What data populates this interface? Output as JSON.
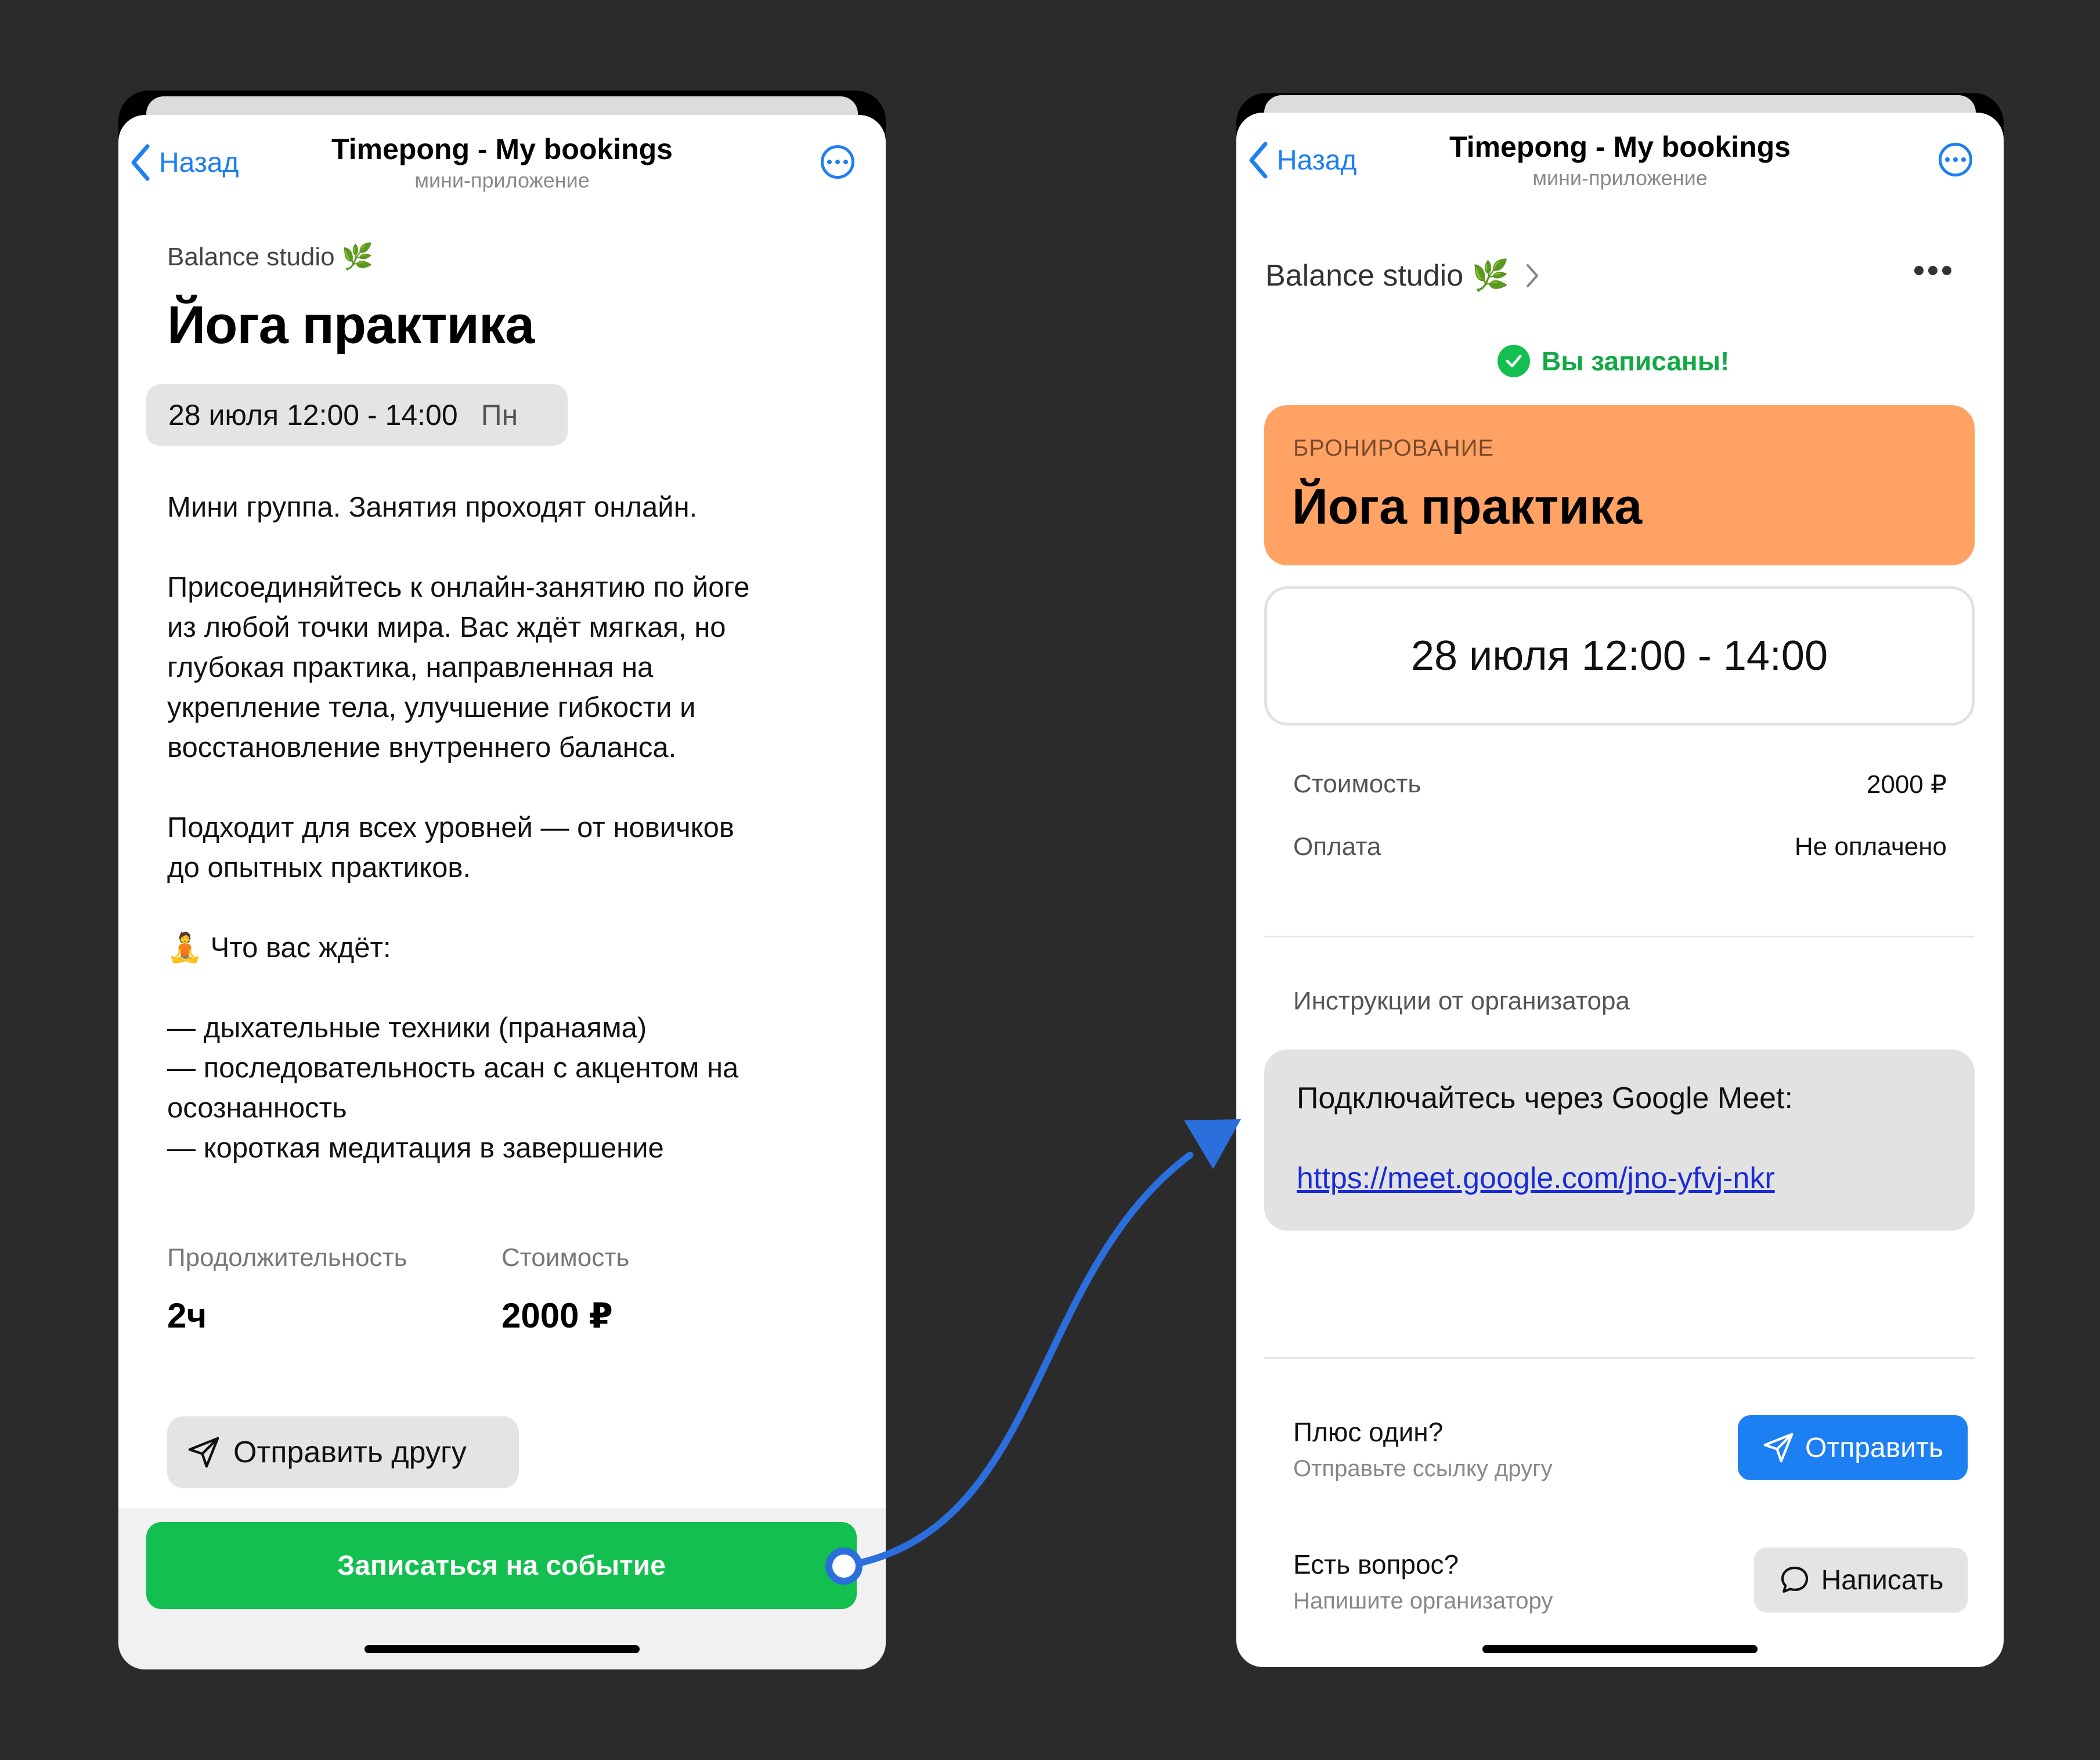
{
  "colors": {
    "accent": "#1c7ff2",
    "green": "#12bf4f",
    "orange": "#ffa264",
    "link": "#1a2bd8",
    "background": "#2b2b2b"
  },
  "header": {
    "back_label": "Назад",
    "title": "Timepong - My bookings",
    "subtitle": "мини-приложение"
  },
  "event": {
    "studio": "Balance studio 🌿",
    "title": "Йога практика",
    "date": "28 июля 12:00 - 14:00",
    "weekday": "Пн",
    "description": [
      "Мини группа. Занятия проходят онлайн.",
      "Присоединяйтесь к онлайн-занятию по йоге\nиз любой точки мира. Вас ждёт мягкая, но\nглубокая практика, направленная на\nукрепление тела, улучшение гибкости и\nвосстановление внутреннего баланса.",
      "Подходит для всех уровней — от новичков\nдо опытных практиков.",
      "🧘 Что вас ждёт:",
      "— дыхательные техники (пранаяма)\n— последовательность асан с акцентом на\nосознанность\n— короткая медитация в завершение"
    ],
    "duration_label": "Продолжительность",
    "duration_value": "2ч",
    "price_label": "Стоимость",
    "price_value": "2000 ₽",
    "share_label": "Отправить другу",
    "register_label": "Записаться на событие"
  },
  "booking": {
    "studio": "Balance studio 🌿",
    "status": "Вы записаны!",
    "section_label": "БРОНИРОВАНИЕ",
    "title": "Йога практика",
    "date": "28 июля 12:00 - 14:00",
    "rows": [
      {
        "label": "Стоимость",
        "value": "2000 ₽"
      },
      {
        "label": "Оплата",
        "value": "Не оплачено"
      }
    ],
    "instructions_label": "Инструкции от организатора",
    "instructions_text": "Подключайтесь через Google Meet:",
    "instructions_link": "https://meet.google.com/jno-yfvj-nkr",
    "plus_one_title": "Плюс один?",
    "plus_one_sub": "Отправьте ссылку другу",
    "send_label": "Отправить",
    "question_title": "Есть вопрос?",
    "question_sub": "Напишите организатору",
    "write_label": "Написать"
  }
}
